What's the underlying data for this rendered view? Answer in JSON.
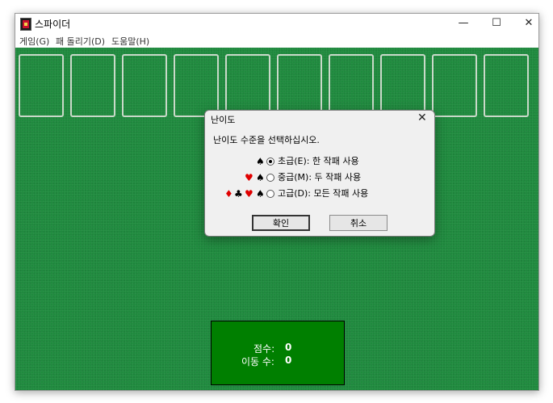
{
  "window": {
    "title": "스파이더",
    "controls": {
      "minimize": "—",
      "maximize": "☐",
      "close": "✕"
    }
  },
  "menu": {
    "items": [
      "게임(G)",
      "패 돌리기(D)",
      "도움말(H)"
    ]
  },
  "board": {
    "felt_color": "#1f8a3e",
    "slot_count": 10
  },
  "score_panel": {
    "score_label": "점수:",
    "score_value": "0",
    "moves_label": "이동 수:",
    "moves_value": "0"
  },
  "dialog": {
    "title": "난이도",
    "close": "✕",
    "prompt": "난이도 수준을 선택하십시오.",
    "options": [
      {
        "suits": [
          "♠"
        ],
        "label": "초급(E): 한 작패 사용",
        "checked": true
      },
      {
        "suits": [
          "♥",
          "♠"
        ],
        "label": "중급(M): 두 작패 사용",
        "checked": false
      },
      {
        "suits": [
          "♦",
          "♣",
          "♥",
          "♠"
        ],
        "label": "고급(D): 모든 작패 사용",
        "checked": false
      }
    ],
    "ok_label": "확인",
    "cancel_label": "취소"
  }
}
